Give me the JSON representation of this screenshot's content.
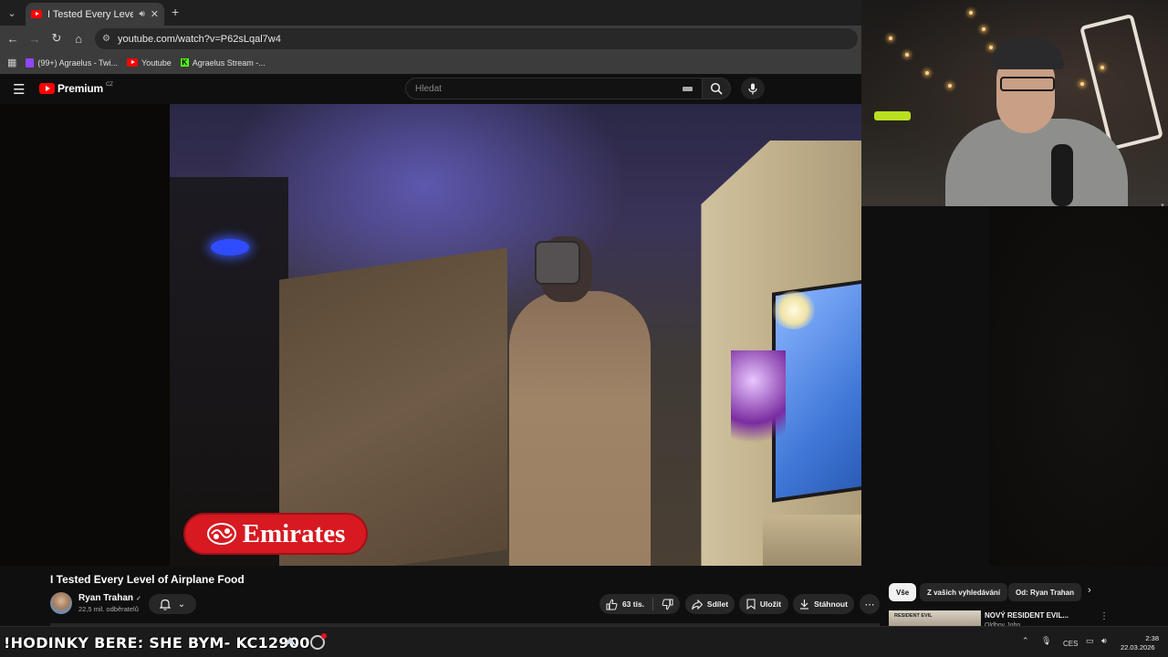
{
  "browser": {
    "tab": {
      "title": "I Tested Every Level of Airpl",
      "audio_icon": "speaker-icon",
      "close": "✕"
    },
    "new_tab": "+",
    "url": "youtube.com/watch?v=P62sLqal7w4",
    "bookmarks": [
      {
        "label": "(99+) Agraelus - Twi...",
        "icon": "twitch-icon"
      },
      {
        "label": "Youtube",
        "icon": "youtube-icon"
      },
      {
        "label": "Agraelus Stream -...",
        "icon": "kick-icon"
      }
    ]
  },
  "youtube": {
    "logo_text": "Premium",
    "logo_country": "CZ",
    "search_placeholder": "Hledat"
  },
  "video": {
    "overlay_brand": "Emirates",
    "title": "I Tested Every Level of Airplane Food",
    "channel": "Ryan Trahan",
    "verified": "✓",
    "subscribers": "22,5 mil. odběratelů",
    "likes": "63 tis.",
    "share": "Sdílet",
    "save": "Uložit",
    "download": "Stáhnout"
  },
  "chips": [
    "Vše",
    "Z vašich vyhledávání",
    "Od: Ryan Trahan"
  ],
  "recommendation": {
    "thumb_text": "RESIDENT EVIL",
    "title": "NOVÝ RESIDENT EVIL...",
    "channel": "Oldboy John"
  },
  "stream_ticker": "!HODINKY BERE: SHE  BYM- KC12900",
  "taskbar": {
    "lang": "CES",
    "time": "2:38",
    "date": "22.03.2026"
  },
  "colors": {
    "brand_red": "#ff0000",
    "emirates_red": "#d71921",
    "chip_active": "#f1f1f1"
  }
}
